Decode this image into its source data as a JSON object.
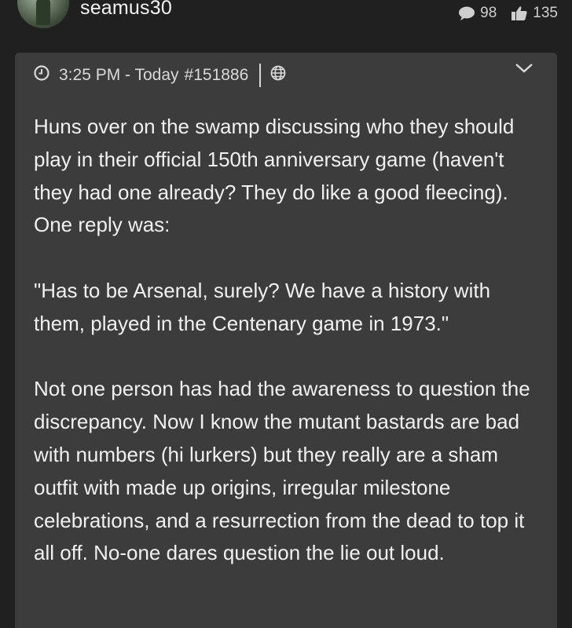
{
  "post": {
    "username": "seamus30",
    "comments_count": "98",
    "likes_count": "135",
    "timestamp": "3:25 PM - Today",
    "post_number": "#151886",
    "paragraphs": [
      "Huns over on the swamp discussing who they should play in their official 150th anniversary game (haven't they had one already? They do like a good fleecing). One reply was:",
      "\"Has to be Arsenal, surely? We have a history with them, played in the Centenary game in 1973.\"",
      "Not one person has had the awareness to question the discrepancy. Now I know the mutant bastards are bad with numbers (hi lurkers) but they really are a sham outfit with made up origins, irregular milestone celebrations, and a resurrection from the dead to top it all off. No-one dares question the lie out loud."
    ]
  },
  "icons": {
    "avatar": "user-avatar",
    "comments": "speech-bubble-icon",
    "likes": "thumbs-up-icon",
    "clock": "clock-icon",
    "globe": "globe-icon",
    "expand": "chevron-down-icon"
  },
  "colors": {
    "page_background": "#202020",
    "card_background": "#3c3c3c",
    "text": "#f0f0f0",
    "meta_text": "#d9d9d9"
  }
}
